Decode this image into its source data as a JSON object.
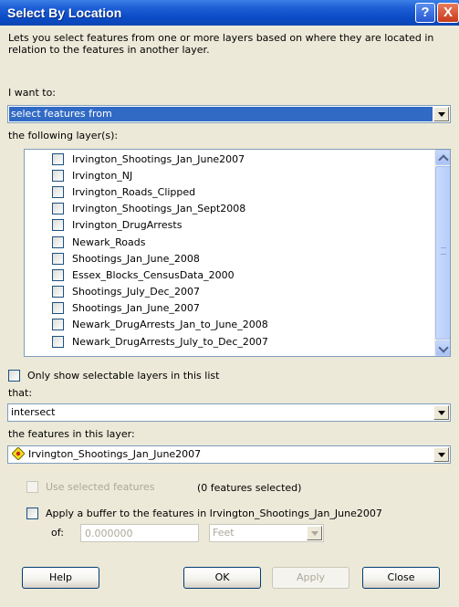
{
  "window": {
    "title": "Select By Location",
    "help_glyph": "?",
    "close_glyph": "X"
  },
  "description": "Lets you select features from one or more layers based on where they are located in relation to the features in another layer.",
  "i_want_to": {
    "label": "I want to:",
    "value": "select features from"
  },
  "layers": {
    "label": "the following layer(s):",
    "items": [
      {
        "label": "Irvington_Shootings_Jan_June2007"
      },
      {
        "label": "Irvington_NJ"
      },
      {
        "label": "Irvington_Roads_Clipped"
      },
      {
        "label": "Irvington_Shootings_Jan_Sept2008"
      },
      {
        "label": "Irvington_DrugArrests"
      },
      {
        "label": "Newark_Roads"
      },
      {
        "label": "Shootings_Jan_June_2008"
      },
      {
        "label": "Essex_Blocks_CensusData_2000"
      },
      {
        "label": "Shootings_July_Dec_2007"
      },
      {
        "label": "Shootings_Jan_June_2007"
      },
      {
        "label": "Newark_DrugArrests_Jan_to_June_2008"
      },
      {
        "label": "Newark_DrugArrests_July_to_Dec_2007"
      }
    ]
  },
  "only_selectable": {
    "label": "Only show selectable layers in this list"
  },
  "that": {
    "label": "that:",
    "value": "intersect"
  },
  "source_layer": {
    "label": "the features in this layer:",
    "value": "Irvington_Shootings_Jan_June2007",
    "icon": "point-layer-icon"
  },
  "use_selected": {
    "label": "Use selected features",
    "count_text": "(0 features selected)"
  },
  "buffer": {
    "label": "Apply a buffer to the features in Irvington_Shootings_Jan_June2007",
    "of_label": "of:",
    "distance": "0.000000",
    "units": "Feet"
  },
  "buttons": {
    "help": "Help",
    "ok": "OK",
    "apply": "Apply",
    "close": "Close"
  },
  "colors": {
    "title_bar": "#0a4bc6",
    "selection": "#316ac5",
    "dialog_bg": "#ece9d8"
  }
}
